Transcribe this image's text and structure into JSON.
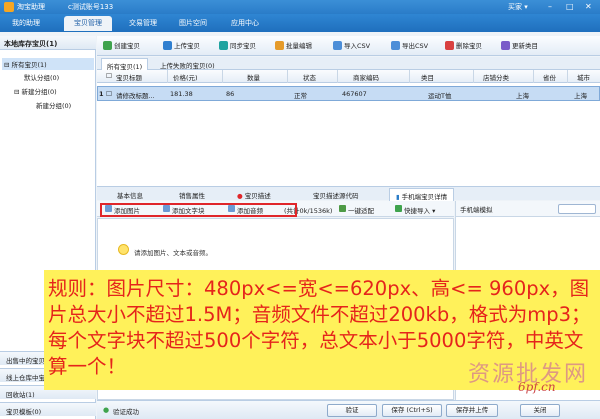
{
  "titlebar": {
    "app": "淘宝助理",
    "account": "c测试账号133",
    "right": "买家 ▾"
  },
  "tabs": [
    "我的助理",
    "宝贝管理",
    "交易管理",
    "图片空间",
    "应用中心"
  ],
  "sidebar": {
    "header": "本地库存宝贝(1)",
    "tree": [
      "所有宝贝(1)",
      "默认分组(0)",
      "新建分组(0)",
      "新建分组(0)"
    ],
    "bottom": [
      "出售中的宝贝",
      "线上仓库中宝贝",
      "回收站(1)",
      "宝贝模板(0)"
    ]
  },
  "toolbar": [
    "创建宝贝",
    "上传宝贝",
    "同步宝贝",
    "批量编辑",
    "导入CSV",
    "导出CSV",
    "删除宝贝",
    "更新类目"
  ],
  "item_tabs": [
    "所有宝贝(1)",
    "上传失败的宝贝(0)"
  ],
  "grid": {
    "headers": [
      "宝贝标题",
      "价格(元)",
      "数量",
      "状态",
      "商家编码",
      "类目",
      "店铺分类",
      "省份",
      "城市"
    ],
    "row": {
      "index": "1",
      "title": "请修改标题...",
      "price": "181.38",
      "qty": "86",
      "status": "正常",
      "code": "467607",
      "category": "运动T恤",
      "shop_cat": "",
      "province": "上海",
      "city": "上海"
    }
  },
  "detail_tabs": [
    "基本信息",
    "销售属性",
    "宝贝描述",
    "宝贝描述源代码",
    "手机端宝贝详情"
  ],
  "editor": {
    "tools": [
      "添加图片",
      "添加文字块",
      "添加音频"
    ],
    "counter": "(共计0k/1536k)",
    "one_click": "一键适配",
    "quick_import": "快捷导入",
    "hint": "请添加图片、文本或音频。"
  },
  "mobile": {
    "label": "手机端模拟"
  },
  "notice": "规则：图片尺寸：480px<=宽<=620px、高<= 960px，图片总大小不超过1.5M；音频文件不超过200kb，格式为mp3；每个文字块不超过500个字符，总文本小于5000字符，中英文算一个！",
  "watermark": {
    "text": "资源批发网",
    "url": "6pf.cn"
  },
  "footer": {
    "status": "验证成功",
    "verify": "验证",
    "save": "保存 (Ctrl+S)",
    "save_upload": "保存并上传",
    "close": "关闭"
  },
  "colors": {
    "brand_blue": "#2a7cc8",
    "notice_bg": "#fff15a",
    "notice_text": "#e5241b",
    "highlight_red": "#e0262a"
  }
}
